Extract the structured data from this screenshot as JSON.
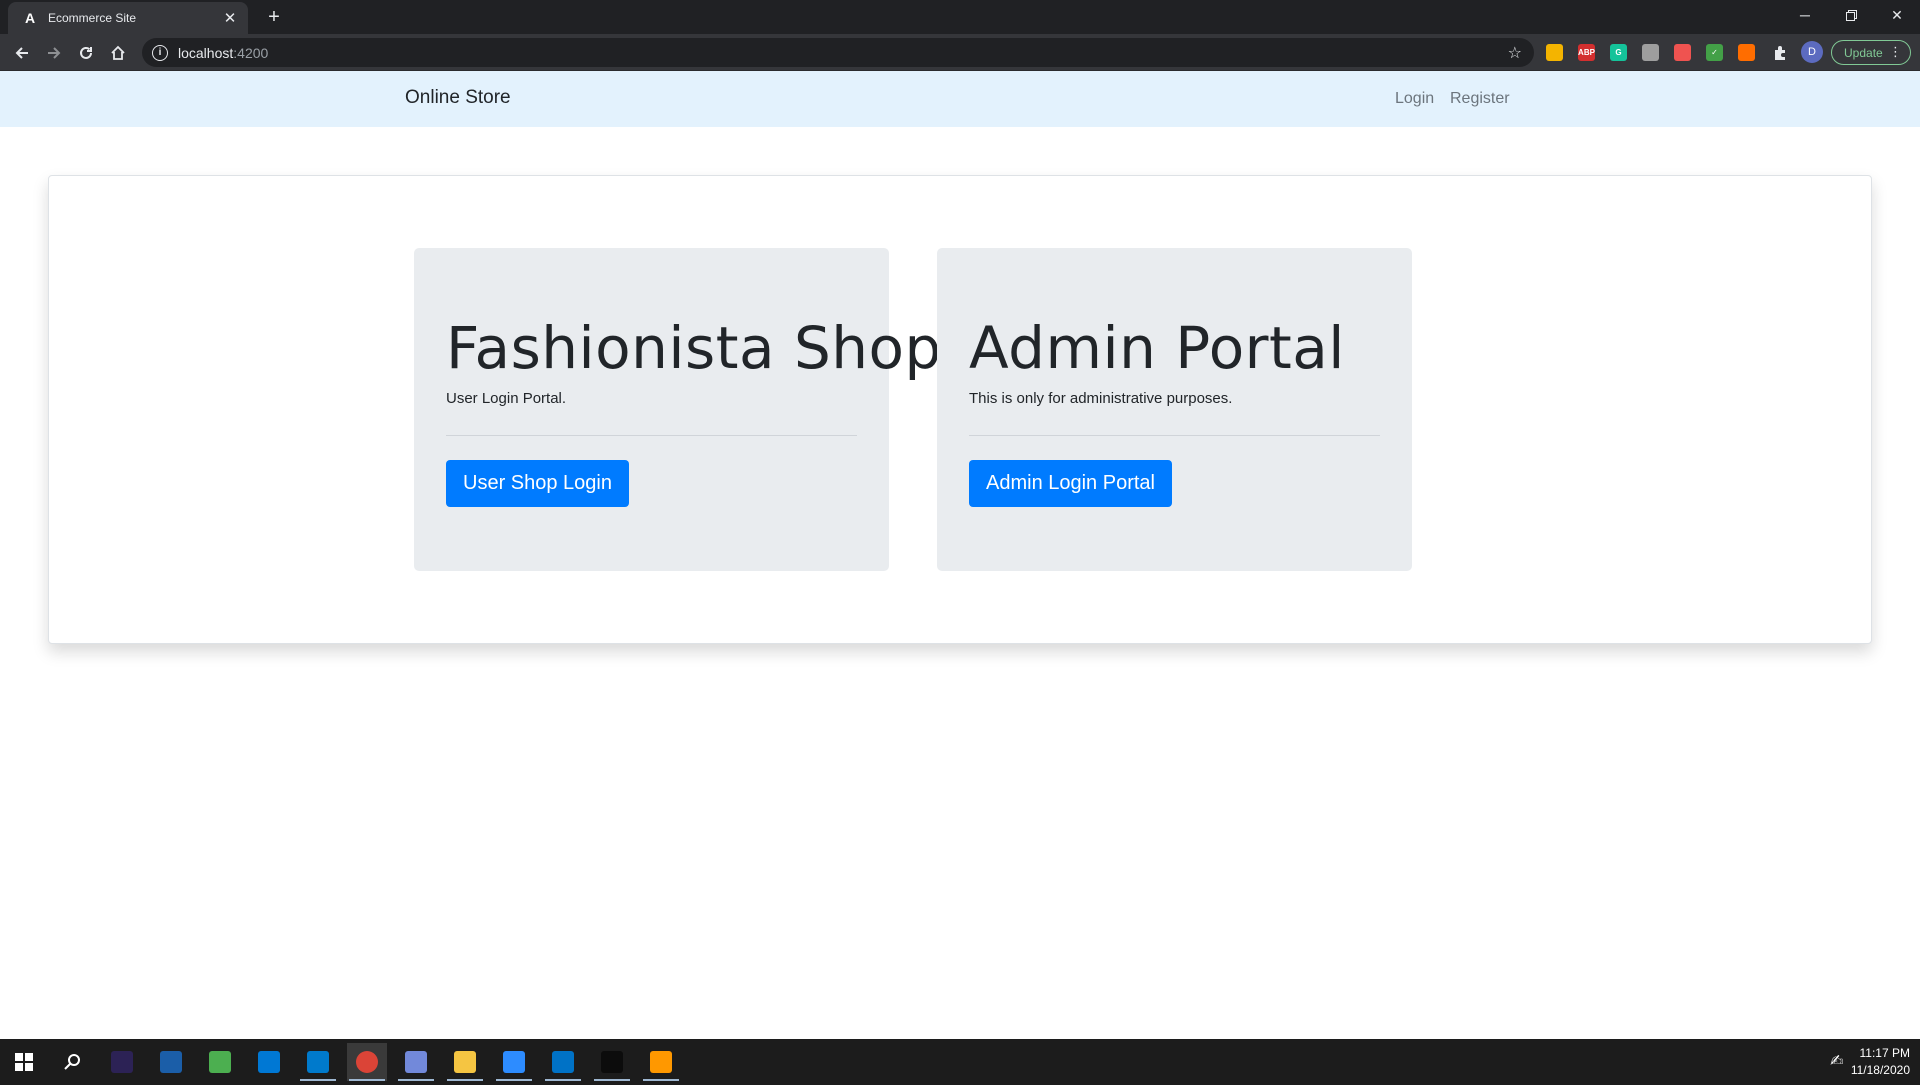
{
  "browser": {
    "tab_title": "Ecommerce Site",
    "tab_favicon": "A",
    "url_host": "localhost",
    "url_port": ":4200",
    "update_label": "Update",
    "avatar_letter": "D",
    "extensions": [
      {
        "name": "notes-extension-icon",
        "label": "",
        "color": "#f4b400"
      },
      {
        "name": "adblock-extension-icon",
        "label": "ABP",
        "color": "#d32f2f"
      },
      {
        "name": "grammarly-extension-icon",
        "label": "G",
        "color": "#15c39a"
      },
      {
        "name": "capture-extension-icon",
        "label": "",
        "color": "#9e9e9e"
      },
      {
        "name": "video-extension-icon",
        "label": "",
        "color": "#ef5350"
      },
      {
        "name": "check-extension-icon",
        "label": "✓",
        "color": "#43a047"
      },
      {
        "name": "fire-extension-icon",
        "label": "",
        "color": "#ff6d00"
      }
    ]
  },
  "navbar": {
    "brand": "Online Store",
    "links": [
      "Login",
      "Register"
    ]
  },
  "cards": [
    {
      "title": "Fashionista Shop",
      "lead": "User Login Portal.",
      "button": "User Shop Login"
    },
    {
      "title": "Admin Portal",
      "lead": "This is only for administrative purposes.",
      "button": "Admin Login Portal"
    }
  ],
  "taskbar": {
    "time": "11:17 PM",
    "date": "11/18/2020",
    "apps": [
      {
        "name": "start-icon"
      },
      {
        "name": "search-icon"
      },
      {
        "name": "eclipse-icon",
        "color": "#2c2255"
      },
      {
        "name": "virtualbox-icon",
        "color": "#1b5ea8"
      },
      {
        "name": "media-app-icon",
        "color": "#4caf50"
      },
      {
        "name": "upload-app-icon",
        "color": "#0078d4"
      },
      {
        "name": "vscode-icon",
        "color": "#007acc"
      },
      {
        "name": "chrome-icon",
        "color": "#db4437"
      },
      {
        "name": "discord-icon",
        "color": "#7289da"
      },
      {
        "name": "file-explorer-icon",
        "color": "#f5c542"
      },
      {
        "name": "zoom-icon",
        "color": "#2d8cff"
      },
      {
        "name": "mail-icon",
        "color": "#0072c6"
      },
      {
        "name": "terminal-icon",
        "color": "#0c0c0c"
      },
      {
        "name": "sublime-icon",
        "color": "#ff9800"
      }
    ]
  }
}
